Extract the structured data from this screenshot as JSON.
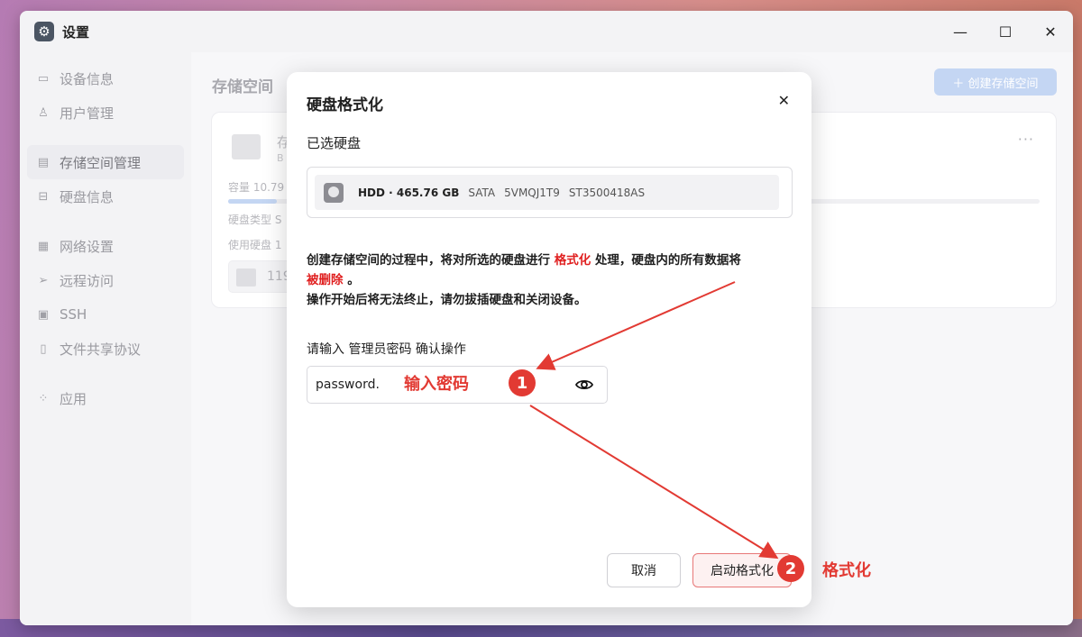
{
  "window": {
    "title": "设置",
    "icon": "gear-icon",
    "controls": {
      "minimize": "—",
      "maximize": "☐",
      "close": "✕"
    }
  },
  "sidebar": {
    "items": [
      {
        "label": "设备信息",
        "icon": "monitor-icon",
        "active": false
      },
      {
        "label": "用户管理",
        "icon": "user-icon",
        "active": false
      },
      {
        "label": "存储空间管理",
        "icon": "storage-icon",
        "active": true
      },
      {
        "label": "硬盘信息",
        "icon": "disk-icon",
        "active": false
      },
      {
        "label": "网络设置",
        "icon": "network-icon",
        "active": false
      },
      {
        "label": "远程访问",
        "icon": "send-icon",
        "active": false
      },
      {
        "label": "SSH",
        "icon": "terminal-icon",
        "active": false
      },
      {
        "label": "文件共享协议",
        "icon": "file-icon",
        "active": false
      },
      {
        "label": "应用",
        "icon": "apps-icon",
        "active": false
      }
    ]
  },
  "main": {
    "title": "存储空间",
    "create_button": "＋ 创建存储空间",
    "card": {
      "name": "存",
      "sub": "B",
      "more": "···",
      "capacity_label": "容量 10.79",
      "disk_type_label": "硬盘类型 S",
      "used_disks_label": "使用硬盘 1",
      "disk_chip_text": "119",
      "capacity_fill_fraction": 0.06
    }
  },
  "dialog": {
    "title": "硬盘格式化",
    "close": "✕",
    "selected_label": "已选硬盘",
    "disk": {
      "main": "HDD · 465.76 GB",
      "interface": "SATA",
      "serial": "5VMQJ1T9",
      "model": "ST3500418AS"
    },
    "warning": {
      "part1": "创建存储空间的过程中，将对所选的硬盘进行 ",
      "highlight1": "格式化",
      "part2": " 处理，硬盘内的所有数据将",
      "highlight2": "被删除",
      "part3": " 。",
      "line2": "操作开始后将无法终止，请勿拔插硬盘和关闭设备。"
    },
    "password_label": "请输入 管理员密码 确认操作",
    "password_value": "password.",
    "cancel_button": "取消",
    "format_button": "启动格式化"
  },
  "annotations": {
    "step1_text": "输入密码",
    "step1_badge": "1",
    "step2_text": "格式化",
    "step2_badge": "2",
    "color": "#e23a33"
  }
}
